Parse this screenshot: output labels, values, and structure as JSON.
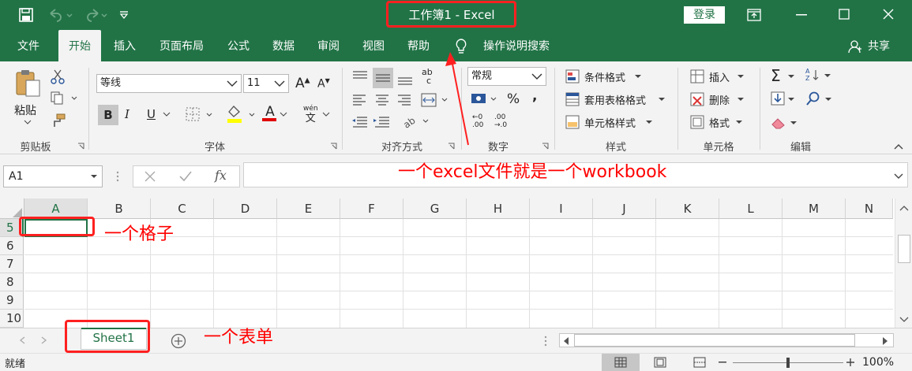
{
  "titlebar": {
    "title": "工作簿1  -  Excel",
    "login_label": "登录"
  },
  "ribbon_tabs": [
    "文件",
    "开始",
    "插入",
    "页面布局",
    "公式",
    "数据",
    "审阅",
    "视图",
    "帮助"
  ],
  "tell_me": "操作说明搜索",
  "share_label": "共享",
  "clipboard": {
    "paste_label": "粘贴",
    "group_label": "剪贴板"
  },
  "font": {
    "name": "等线",
    "size": "11",
    "group_label": "字体",
    "bold": "B",
    "italic": "I",
    "underline": "U",
    "grow": "A",
    "shrink": "A",
    "color_letter": "A",
    "phonetic_top": "wén",
    "phonetic_bottom": "文"
  },
  "alignment": {
    "group_label": "对齐方式",
    "wrap_top": "ab",
    "wrap_bottom": "c"
  },
  "number": {
    "format": "常规",
    "group_label": "数字",
    "percent": "%",
    "comma": ",",
    "inc_top": "←0",
    "inc_bottom": ".00",
    "dec_top": ".00",
    "dec_bottom": "→.0"
  },
  "styles": {
    "conditional": "条件格式",
    "table": "套用表格格式",
    "cell": "单元格样式",
    "group_label": "样式"
  },
  "cells": {
    "insert": "插入",
    "delete": "删除",
    "format": "格式",
    "group_label": "单元格"
  },
  "editing": {
    "group_label": "编辑",
    "sum": "Σ",
    "sort_top": "A",
    "sort_bottom": "Z"
  },
  "formula_bar": {
    "name_box": "A1",
    "fx": "fx",
    "formula": ""
  },
  "grid": {
    "columns": [
      "A",
      "B",
      "C",
      "D",
      "E",
      "F",
      "G",
      "H",
      "I",
      "J",
      "K",
      "L",
      "M",
      "N"
    ],
    "rows": [
      "5",
      "6",
      "7",
      "8",
      "9",
      "10"
    ]
  },
  "sheets": {
    "active": "Sheet1"
  },
  "status": {
    "ready": "就绪",
    "zoom": "100%"
  },
  "annotations": {
    "workbook": "一个excel文件就是一个workbook",
    "cell": "一个格子",
    "sheet": "一个表单"
  },
  "colors": {
    "brand": "#217346",
    "annotation": "#ff0000"
  }
}
